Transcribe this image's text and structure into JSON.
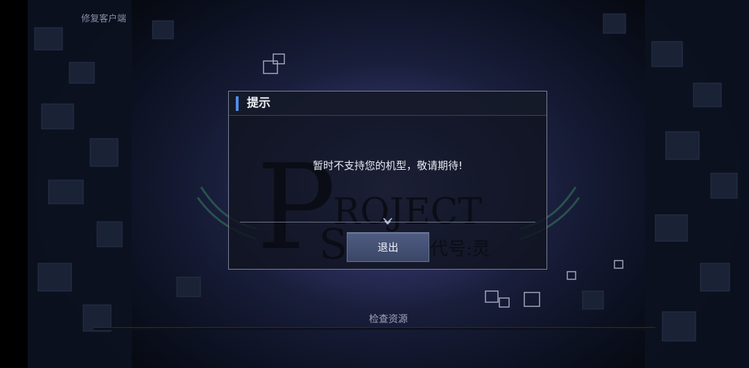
{
  "top_left": {
    "repair_client": "修复客户端"
  },
  "dialog": {
    "title": "提示",
    "message": "暂时不支持您的机型，敬请期待!",
    "exit_button": "退出"
  },
  "background_logo": {
    "letter": "P",
    "word": "ROJECT",
    "sub_letter": "S",
    "sub_text": "代号:灵"
  },
  "bottom": {
    "status": "检查资源",
    "progress": 0
  },
  "colors": {
    "accent": "#4f8fe6",
    "button": "#46537a",
    "dialog_border": "#7c8296"
  },
  "icons": {
    "divider": "chevron-down-icon"
  }
}
